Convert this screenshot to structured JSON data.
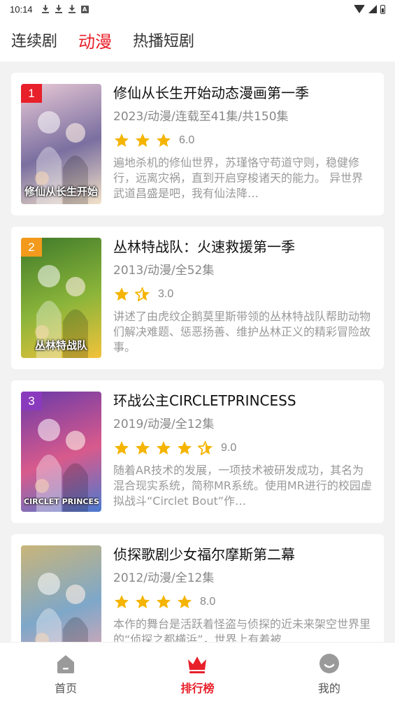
{
  "status": {
    "time": "10:14",
    "a_badge": "A"
  },
  "tabs": [
    {
      "label": "连续剧",
      "active": false
    },
    {
      "label": "动漫",
      "active": true
    },
    {
      "label": "热播短剧",
      "active": false
    }
  ],
  "items": [
    {
      "rank": "1",
      "rank_color": "#e8202a",
      "title": "修仙从长生开始动态漫画第一季",
      "meta": "2023/动漫/连载至41集/共150集",
      "score": "6.0",
      "stars": 3,
      "desc": "遍地杀机的修仙世界，苏瑾恪守苟道守则，稳健修行，远离灾祸，直到开启穿梭诸天的能力。 异世界武道昌盛是吧，我有仙法降…",
      "poster_text": "修仙从长生开始",
      "poster_colors": [
        "#e9c9d6",
        "#7a6fa0",
        "#f3e2c8"
      ]
    },
    {
      "rank": "2",
      "rank_color": "#f39a1d",
      "title": "丛林特战队：火速救援第一季",
      "meta": "2013/动漫/全52集",
      "score": "3.0",
      "stars": 1.5,
      "desc": "讲述了由虎纹企鹅莫里斯带领的丛林特战队帮助动物们解决难题、惩恶扬善、维护丛林正义的精彩冒险故事。",
      "poster_text": "丛林特战队",
      "poster_colors": [
        "#3f7a2a",
        "#8bb53a",
        "#f2c23a"
      ]
    },
    {
      "rank": "3",
      "rank_color": "#8a3bbd",
      "title": "环战公主CIRCLETPRINCESS",
      "meta": "2019/动漫/全12集",
      "score": "9.0",
      "stars": 4.5,
      "desc": "随着AR技术的发展，一项技术被研发成功，其名为混合现实系统，简称MR系统。使用MR进行的校园虚拟战斗“Circlet Bout”作…",
      "poster_text": "CIRCLET PRINCESS",
      "poster_colors": [
        "#6b3aa8",
        "#d85a8c",
        "#4a7ad0"
      ]
    },
    {
      "rank": "",
      "rank_color": "",
      "title": "侦探歌剧少女福尔摩斯第二幕",
      "meta": "2012/动漫/全12集",
      "score": "8.0",
      "stars": 4,
      "desc": "本作的舞台是活跃着怪盗与侦探的近未来架空世界里的“侦探之都横浜”，世界上有着被…",
      "poster_text": "",
      "poster_colors": [
        "#c9b57a",
        "#7ea7c9",
        "#e6a7b3"
      ]
    }
  ],
  "nav": [
    {
      "label": "首页",
      "icon": "home-icon",
      "active": false
    },
    {
      "label": "排行榜",
      "icon": "crown-icon",
      "active": true
    },
    {
      "label": "我的",
      "icon": "profile-icon",
      "active": false
    }
  ],
  "colors": {
    "accent": "#e8202a",
    "star": "#f5b400"
  }
}
